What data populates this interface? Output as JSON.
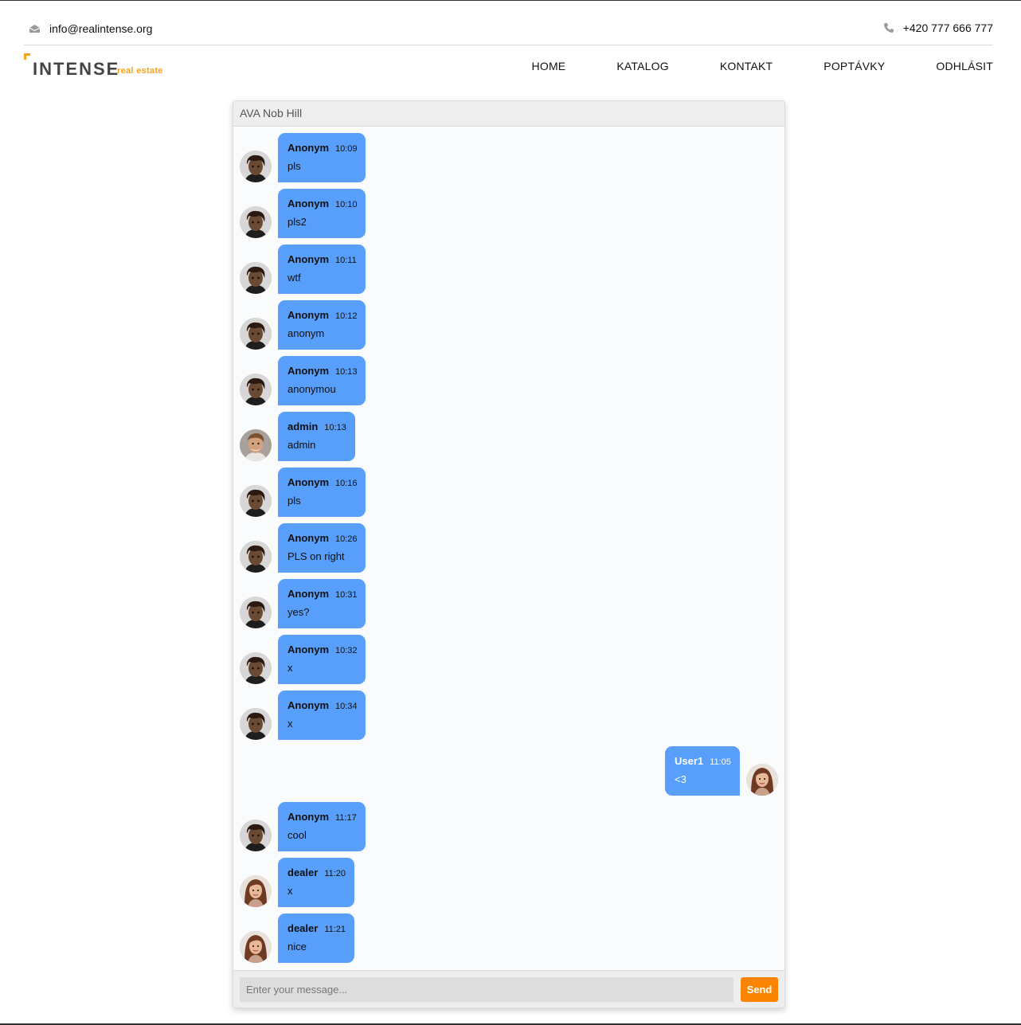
{
  "topbar": {
    "email": "info@realintense.org",
    "phone": "+420 777 666 777"
  },
  "logo": {
    "name": "INTENSE",
    "sub": "real estate"
  },
  "nav": {
    "home": "HOME",
    "katalog": "KATALOG",
    "kontakt": "KONTAKT",
    "poptavky": "POPTÁVKY",
    "odhlasit": "ODHLÁSIT"
  },
  "chat": {
    "title": "AVA Nob Hill",
    "placeholder": "Enter your message...",
    "send": "Send",
    "messages": [
      {
        "name": "Anonym",
        "time": "10:09",
        "text": "pls",
        "side": "left",
        "avatar": "anonym"
      },
      {
        "name": "Anonym",
        "time": "10:10",
        "text": "pls2",
        "side": "left",
        "avatar": "anonym"
      },
      {
        "name": "Anonym",
        "time": "10:11",
        "text": "wtf",
        "side": "left",
        "avatar": "anonym"
      },
      {
        "name": "Anonym",
        "time": "10:12",
        "text": "anonym",
        "side": "left",
        "avatar": "anonym"
      },
      {
        "name": "Anonym",
        "time": "10:13",
        "text": "anonymou",
        "side": "left",
        "avatar": "anonym"
      },
      {
        "name": "admin",
        "time": "10:13",
        "text": "admin",
        "side": "left",
        "avatar": "admin"
      },
      {
        "name": "Anonym",
        "time": "10:16",
        "text": "pls",
        "side": "left",
        "avatar": "anonym"
      },
      {
        "name": "Anonym",
        "time": "10:26",
        "text": "PLS on right",
        "side": "left",
        "avatar": "anonym"
      },
      {
        "name": "Anonym",
        "time": "10:31",
        "text": "yes?",
        "side": "left",
        "avatar": "anonym"
      },
      {
        "name": "Anonym",
        "time": "10:32",
        "text": "x",
        "side": "left",
        "avatar": "anonym"
      },
      {
        "name": "Anonym",
        "time": "10:34",
        "text": "x",
        "side": "left",
        "avatar": "anonym"
      },
      {
        "name": "User1",
        "time": "11:05",
        "text": "<3",
        "side": "right",
        "avatar": "woman"
      },
      {
        "name": "Anonym",
        "time": "11:17",
        "text": "cool",
        "side": "left",
        "avatar": "anonym"
      },
      {
        "name": "dealer",
        "time": "11:20",
        "text": "x",
        "side": "left",
        "avatar": "woman"
      },
      {
        "name": "dealer",
        "time": "11:21",
        "text": "nice",
        "side": "left",
        "avatar": "woman"
      }
    ]
  }
}
